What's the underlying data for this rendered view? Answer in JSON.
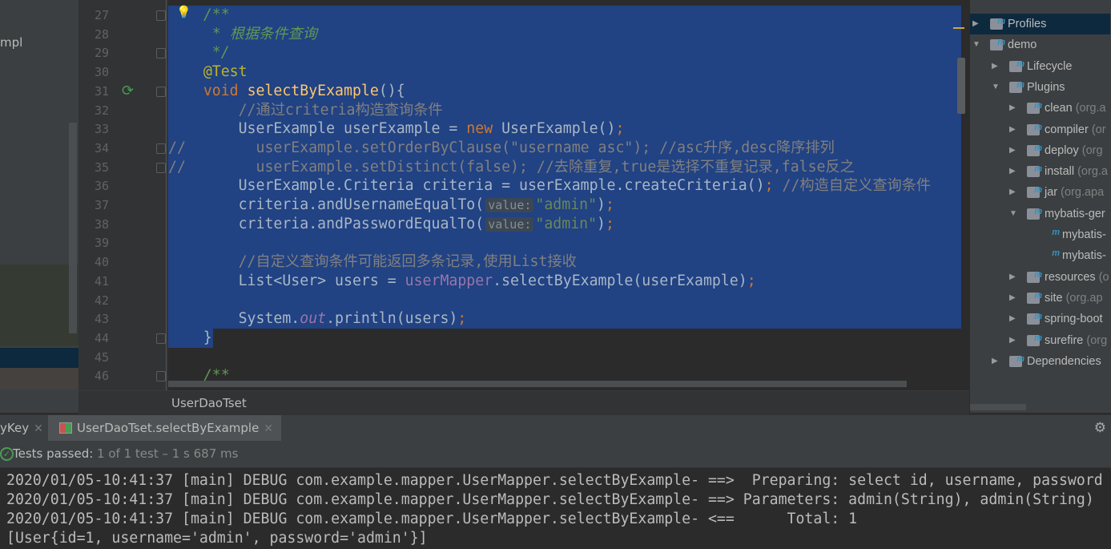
{
  "left_panel": {
    "visible_text": "mpl",
    "tab_partial": "yKey"
  },
  "editor": {
    "file_tab": "UserDaoTset",
    "line_numbers": [
      27,
      28,
      29,
      30,
      31,
      32,
      33,
      34,
      35,
      36,
      37,
      38,
      39,
      40,
      41,
      42,
      43,
      44,
      45,
      46
    ],
    "lines": [
      [
        {
          "t": "    "
        },
        {
          "t": "/**",
          "c": "doc"
        }
      ],
      [
        {
          "t": "     "
        },
        {
          "t": "* 根据条件查询",
          "c": "doc"
        }
      ],
      [
        {
          "t": "     "
        },
        {
          "t": "*/",
          "c": "doc"
        }
      ],
      [
        {
          "t": "    "
        },
        {
          "t": "@Test",
          "c": "an"
        }
      ],
      [
        {
          "t": "    "
        },
        {
          "t": "void ",
          "c": "kw"
        },
        {
          "t": "selectByExample",
          "c": "fn"
        },
        {
          "t": "(){"
        }
      ],
      [
        {
          "t": "        "
        },
        {
          "t": "//通过criteria构造查询条件",
          "c": "cm"
        }
      ],
      [
        {
          "t": "        UserExample userExample = "
        },
        {
          "t": "new ",
          "c": "kw"
        },
        {
          "t": "UserExample()"
        },
        {
          "t": ";",
          "c": "kw"
        }
      ],
      [
        {
          "t": "//        userExample.setOrderByClause(\"username asc\"); //asc升序,desc降序排列",
          "c": "cm"
        }
      ],
      [
        {
          "t": "//        userExample.setDistinct(false); //去除重复,true是选择不重复记录,false反之",
          "c": "cm"
        }
      ],
      [
        {
          "t": "        UserExample.Criteria criteria = userExample.createCriteria()"
        },
        {
          "t": "; ",
          "c": "kw"
        },
        {
          "t": "//构造自定义查询条件",
          "c": "cm"
        }
      ],
      [
        {
          "t": "        criteria.andUsernameEqualTo("
        },
        {
          "t": "value:",
          "c": "hint"
        },
        {
          "t": "\"admin\"",
          "c": "st"
        },
        {
          "t": ")"
        },
        {
          "t": ";",
          "c": "kw"
        }
      ],
      [
        {
          "t": "        criteria.andPasswordEqualTo("
        },
        {
          "t": "value:",
          "c": "hint"
        },
        {
          "t": "\"admin\"",
          "c": "st"
        },
        {
          "t": ")"
        },
        {
          "t": ";",
          "c": "kw"
        }
      ],
      [
        {
          "t": ""
        }
      ],
      [
        {
          "t": "        "
        },
        {
          "t": "//自定义查询条件可能返回多条记录,使用List接收",
          "c": "cm"
        }
      ],
      [
        {
          "t": "        List<User> users = "
        },
        {
          "t": "userMapper",
          "c": "fld"
        },
        {
          "t": ".selectByExample(userExample)"
        },
        {
          "t": ";",
          "c": "kw"
        }
      ],
      [
        {
          "t": ""
        }
      ],
      [
        {
          "t": "        System."
        },
        {
          "t": "out",
          "c": "sfld"
        },
        {
          "t": ".println(users)"
        },
        {
          "t": ";",
          "c": "kw"
        }
      ],
      [
        {
          "t": "    }"
        }
      ],
      [
        {
          "t": ""
        }
      ],
      [
        {
          "t": "    "
        },
        {
          "t": "/**",
          "c": "doc"
        }
      ]
    ],
    "selected_lines": "27-44"
  },
  "maven_panel": {
    "items": [
      {
        "label": "Profiles",
        "sub": "",
        "arrow": "▶",
        "level": 0,
        "icon": "folder-profiles-icon"
      },
      {
        "label": "demo",
        "sub": "",
        "arrow": "▼",
        "level": 0,
        "icon": "maven-module-icon"
      },
      {
        "label": "Lifecycle",
        "sub": "",
        "arrow": "▶",
        "level": 1,
        "icon": "folder-gear-icon"
      },
      {
        "label": "Plugins",
        "sub": "",
        "arrow": "▼",
        "level": 1,
        "icon": "folder-gear-icon"
      },
      {
        "label": "clean",
        "sub": " (org.a",
        "arrow": "▶",
        "level": 2,
        "icon": "plugin-icon"
      },
      {
        "label": "compiler",
        "sub": " (or",
        "arrow": "▶",
        "level": 2,
        "icon": "plugin-icon"
      },
      {
        "label": "deploy",
        "sub": " (org",
        "arrow": "▶",
        "level": 2,
        "icon": "plugin-icon"
      },
      {
        "label": "install",
        "sub": " (org.a",
        "arrow": "▶",
        "level": 2,
        "icon": "plugin-icon"
      },
      {
        "label": "jar",
        "sub": " (org.apa",
        "arrow": "▶",
        "level": 2,
        "icon": "plugin-icon"
      },
      {
        "label": "mybatis-ger",
        "sub": "",
        "arrow": "▼",
        "level": 2,
        "icon": "plugin-icon"
      },
      {
        "label": "mybatis-",
        "sub": "",
        "arrow": "",
        "level": 3,
        "icon": "goal-icon"
      },
      {
        "label": "mybatis-",
        "sub": "",
        "arrow": "",
        "level": 3,
        "icon": "goal-icon"
      },
      {
        "label": "resources",
        "sub": " (o",
        "arrow": "▶",
        "level": 2,
        "icon": "plugin-icon"
      },
      {
        "label": "site",
        "sub": " (org.ap",
        "arrow": "▶",
        "level": 2,
        "icon": "plugin-icon"
      },
      {
        "label": "spring-boot",
        "sub": "",
        "arrow": "▶",
        "level": 2,
        "icon": "plugin-icon"
      },
      {
        "label": "surefire",
        "sub": " (org",
        "arrow": "▶",
        "level": 2,
        "icon": "plugin-icon"
      },
      {
        "label": "Dependencies",
        "sub": "",
        "arrow": "▶",
        "level": 1,
        "icon": "dependencies-icon"
      }
    ]
  },
  "run_panel": {
    "tabs": [
      {
        "label": "yKey"
      },
      {
        "label": "UserDaoTset.selectByExample"
      }
    ],
    "status_prefix": "Tests passed: ",
    "status_count": "1",
    "status_rest": " of 1 test – 1 s 687 ms",
    "console": [
      "2020/01/05-10:41:37 [main] DEBUG com.example.mapper.UserMapper.selectByExample- ==>  Preparing: select id, username, password",
      "2020/01/05-10:41:37 [main] DEBUG com.example.mapper.UserMapper.selectByExample- ==> Parameters: admin(String), admin(String)",
      "2020/01/05-10:41:37 [main] DEBUG com.example.mapper.UserMapper.selectByExample- <==      Total: 1",
      "[User{id=1, username='admin', password='admin'}]"
    ]
  }
}
